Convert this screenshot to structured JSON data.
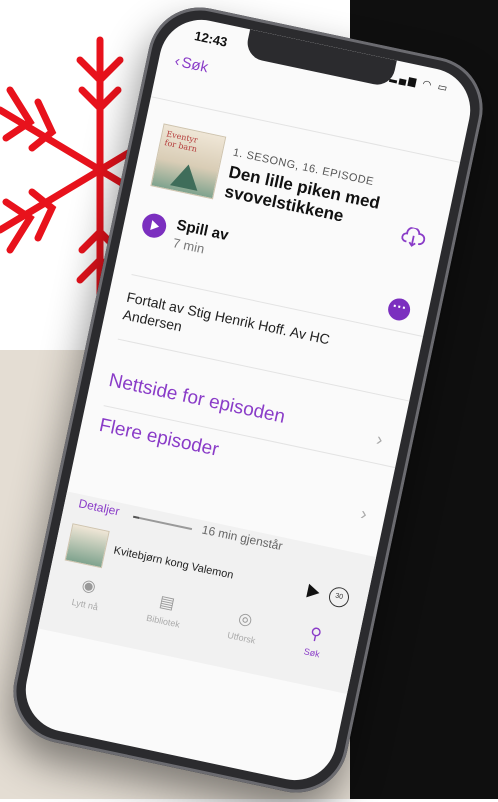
{
  "status_bar": {
    "time": "12:43"
  },
  "nav": {
    "back_label": "Søk"
  },
  "episode": {
    "season_episode": "1. SESONG, 16. EPISODE",
    "title": "Den lille piken med svovelstikkene",
    "play_label": "Spill av",
    "duration": "7 min",
    "description": "Fortalt av Stig Henrik Hoff. Av HC Andersen",
    "cover_text": "Eventyr for barn og foreldre"
  },
  "links": [
    {
      "label": "Nettside for episoden"
    },
    {
      "label": "Flere episoder"
    }
  ],
  "mini_player": {
    "details_label": "Detaljer",
    "remaining": "16 min gjenstår",
    "progress_fraction": 0.1,
    "now_playing_title": "Kvitebjørn kong Valemon",
    "skip_seconds": "30"
  },
  "tabs": [
    {
      "label": "Lytt nå",
      "icon": "play-circle-icon",
      "active": false
    },
    {
      "label": "Bibliotek",
      "icon": "library-icon",
      "active": false
    },
    {
      "label": "Utforsk",
      "icon": "podcast-icon",
      "active": false
    },
    {
      "label": "Søk",
      "icon": "search-icon",
      "active": true
    }
  ],
  "colors": {
    "accent": "#8a3cc8",
    "snowflake": "#e8121c",
    "phone_frame": "#2b2b2e",
    "background_dark": "#0f0f0f",
    "background_beige": "#e4ddd3"
  }
}
